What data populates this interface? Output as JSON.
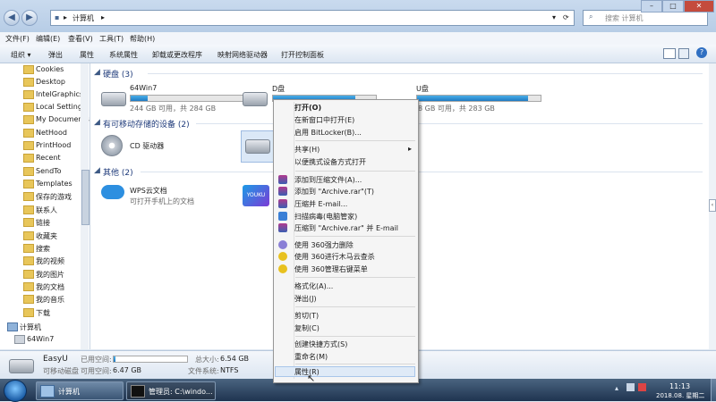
{
  "window": {
    "address_root": "计算机",
    "search_placeholder": "搜索 计算机",
    "controls": {
      "minimize": "–",
      "maximize": "□",
      "close": "✕"
    }
  },
  "menubar": [
    "文件(F)",
    "编辑(E)",
    "查看(V)",
    "工具(T)",
    "帮助(H)"
  ],
  "toolbar": {
    "organize": "组织 ▾",
    "items": [
      "弹出",
      "属性",
      "系统属性",
      "卸载或更改程序",
      "映射网络驱动器",
      "打开控制面板"
    ]
  },
  "nav": {
    "items": [
      "Cookies",
      "Desktop",
      "IntelGraphicsP",
      "Local Settings",
      "My Documents",
      "NetHood",
      "PrintHood",
      "Recent",
      "SendTo",
      "Templates",
      "保存的游戏",
      "联系人",
      "链接",
      "收藏夹",
      "搜索",
      "我的视频",
      "我的图片",
      "我的文档",
      "我的音乐",
      "下载",
      "计算机",
      "64Win7"
    ]
  },
  "content": {
    "group_hdd": "硬盘 (3)",
    "group_removable": "有可移动存储的设备 (2)",
    "group_other": "其他 (2)",
    "drives": [
      {
        "name": "64Win7",
        "info": "244 GB 可用，共 284 GB",
        "used": 0.14
      },
      {
        "name": "D盘",
        "info": "",
        "used": 0.8
      },
      {
        "name": "U盘",
        "info": "8 GB 可用，共 283 GB",
        "used": 0.9
      }
    ],
    "cd": "CD 驱动器",
    "wps_name": "WPS云文档",
    "wps_desc": "可打开手机上的文档",
    "youku_label": "YOUKU"
  },
  "details": {
    "name": "EasyU",
    "type": "可移动磁盘",
    "used_label": "已用空间:",
    "free_label": "可用空间:",
    "free_value": "6.47 GB",
    "total_label": "总大小:",
    "total_value": "6.54 GB",
    "fs_label": "文件系统:",
    "fs_value": "NTFS",
    "used_fraction": 0.02
  },
  "context_menu": {
    "items": [
      {
        "label": "打开(O)",
        "bold": true
      },
      {
        "label": "在新窗口中打开(E)"
      },
      {
        "label": "启用 BitLocker(B)..."
      },
      {
        "label": "共享(H)",
        "submenu": true
      },
      {
        "label": "以便携式设备方式打开"
      },
      {
        "label": "添加到压缩文件(A)...",
        "icon": "winrar-icon"
      },
      {
        "label": "添加到 \"Archive.rar\"(T)",
        "icon": "winrar-icon"
      },
      {
        "label": "压缩并 E-mail...",
        "icon": "winrar-icon"
      },
      {
        "label": "扫描病毒(电脑管家)",
        "icon": "shield-icon"
      },
      {
        "label": "压缩到 \"Archive.rar\" 并 E-mail",
        "icon": "winrar-icon"
      },
      {
        "label": "使用 360强力删除",
        "icon": "360-icon"
      },
      {
        "label": "使用 360进行木马云查杀",
        "icon": "360-icon"
      },
      {
        "label": "使用 360管理右键菜单",
        "icon": "360-icon"
      },
      {
        "label": "格式化(A)..."
      },
      {
        "label": "弹出(J)"
      },
      {
        "label": "剪切(T)"
      },
      {
        "label": "复制(C)"
      },
      {
        "label": "创建快捷方式(S)"
      },
      {
        "label": "重命名(M)"
      },
      {
        "label": "属性(R)"
      }
    ]
  },
  "taskbar": {
    "explorer": "计算机",
    "cmd": "管理员: C:\\windo...",
    "time": "11:13",
    "date": "2018.08. 星期二"
  },
  "colors": {
    "accent": "#1f7ac2",
    "header_text": "#1e3a7a"
  }
}
